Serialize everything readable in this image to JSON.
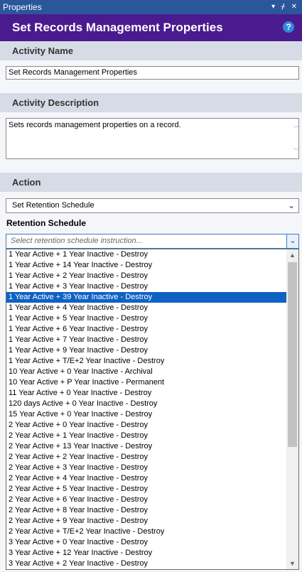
{
  "pane": {
    "title": "Properties",
    "controls": "▾ ᚋ ✕"
  },
  "header": {
    "title": "Set Records Management Properties",
    "help": "?"
  },
  "activity_name": {
    "section": "Activity Name",
    "value": "Set Records Management Properties"
  },
  "activity_description": {
    "section": "Activity Description",
    "value": "Sets records management properties on a record."
  },
  "action": {
    "section": "Action",
    "selected": "Set Retention Schedule"
  },
  "retention": {
    "label": "Retention Schedule",
    "placeholder": "Select retention schedule instruction...",
    "selected_index": 4,
    "options": [
      "1 Year Active + 1 Year Inactive - Destroy",
      "1 Year Active + 14 Year Inactive - Destroy",
      "1 Year Active + 2 Year Inactive - Destroy",
      "1 Year Active + 3 Year Inactive - Destroy",
      "1 Year Active + 39 Year Inactive - Destroy",
      "1 Year Active + 4 Year Inactive - Destroy",
      "1 Year Active + 5 Year Inactive - Destroy",
      "1 Year Active + 6 Year Inactive - Destroy",
      "1 Year Active + 7 Year Inactive - Destroy",
      "1 Year Active + 9 Year Inactive - Destroy",
      "1 Year Active + T/E+2 Year Inactive - Destroy",
      "10 Year Active + 0 Year Inactive - Archival",
      "10 Year Active + P Year Inactive - Permanent",
      "11 Year Active + 0 Year Inactive - Destroy",
      "120 days Active + 0 Year Inactive - Destroy",
      "15 Year Active + 0 Year Inactive - Destroy",
      "2 Year Active + 0 Year Inactive - Destroy",
      "2 Year Active + 1 Year Inactive - Destroy",
      "2 Year Active + 13 Year Inactive - Destroy",
      "2 Year Active + 2 Year Inactive - Destroy",
      "2 Year Active + 3 Year Inactive - Destroy",
      "2 Year Active + 4 Year Inactive - Destroy",
      "2 Year Active + 5 Year Inactive - Destroy",
      "2 Year Active + 6 Year Inactive - Destroy",
      "2 Year Active + 8 Year Inactive - Destroy",
      "2 Year Active + 9 Year Inactive - Destroy",
      "2 Year Active + T/E+2 Year Inactive - Destroy",
      "3 Year Active + 0 Year Inactive - Destroy",
      "3 Year Active + 12 Year Inactive - Destroy",
      "3 Year Active + 2 Year Inactive - Destroy"
    ]
  },
  "colors": {
    "header": "#4a1a8f",
    "titlebar": "#2b579a",
    "selection": "#0f62c4",
    "section": "#d6dbe5"
  },
  "icons": {
    "help": "help-icon",
    "dropdown": "chevron-down-icon"
  }
}
